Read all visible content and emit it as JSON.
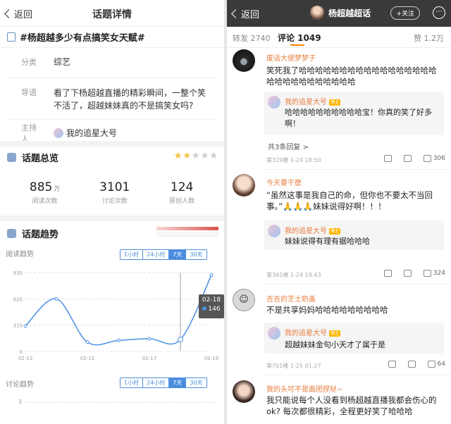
{
  "left": {
    "back_label": "返回",
    "title": "话题详情",
    "topic": "#杨超越多少有点搞笑女天赋#",
    "category_label": "分类",
    "category_value": "综艺",
    "guide_label": "导语",
    "guide_value": "看了下杨超越直播的精彩瞬间，一整个笑不活了，超越妹妹真的不是搞笑女吗?",
    "host_label": "主持人",
    "host_value": "我的追星大号",
    "overview_title": "话题总览",
    "rating_stars": "2 of 5",
    "stats": [
      {
        "value": "885",
        "unit": "万",
        "label": "阅读次数"
      },
      {
        "value": "3101",
        "unit": "",
        "label": "讨论次数"
      },
      {
        "value": "124",
        "unit": "",
        "label": "原创人数"
      }
    ],
    "trend_title": "话题趋势",
    "read_trend_label": "阅读趋势",
    "discuss_trend_label": "讨论趋势",
    "tabs": [
      "1小时",
      "24小时",
      "7天",
      "30天"
    ],
    "active_tab": "7天",
    "tooltip_date": "02-18",
    "tooltip_value": "146",
    "discuss_axis_tick": "3"
  },
  "chart_data": {
    "type": "line",
    "title": "阅读趋势",
    "x": [
      "02-13",
      "02-14",
      "02-15",
      "02-16",
      "02-17",
      "02-18",
      "02-19"
    ],
    "x_tick_labels": [
      "02-13",
      "02-15",
      "02-17",
      "02-19"
    ],
    "values": [
      300,
      620,
      110,
      130,
      150,
      140,
      900
    ],
    "y_ticks": [
      "930",
      "620",
      "310",
      "0"
    ],
    "ylim": [
      0,
      930
    ],
    "highlight": {
      "x": "02-18",
      "value": 146
    },
    "line_color": "#4a90e2",
    "grid": true
  },
  "right": {
    "back_label": "返回",
    "page_title": "杨超越超话",
    "follow_label": "+关注",
    "tab_repost": "转发 2740",
    "tab_comment": "评论 1049",
    "tab_like": "赞 1.2万",
    "comments": [
      {
        "name": "废话大使梦梦子",
        "text": "笑死我了哈哈哈哈哈哈哈哈哈哈哈哈哈哈哈哈哈哈哈哈哈哈哈哈哈哈哈哈",
        "reply_name": "我的追星大号",
        "reply_badge": "博主",
        "reply_text": "哈哈哈哈哈哈哈哈哈哈宝！你真的笑了好多啊！",
        "more": "共3条回复 >",
        "meta": "第329楼 1-24 18:50",
        "count": "306"
      },
      {
        "name": "今天要干麽",
        "text": "“虽然这事是我自己的命，但你也不要太不当回事。”🙏🙏🙏妹妹说得好啊！！！",
        "reply_name": "我的追星大号",
        "reply_badge": "博主",
        "reply_text": "妹妹说得有理有据哈哈哈",
        "more": "",
        "meta": "第361楼 1-24 19:43",
        "count": "324"
      },
      {
        "name": "吉吉的芝士奶盖",
        "text": "不是共享妈妈哈哈哈哈哈哈哈哈哈",
        "reply_name": "我的追星大号",
        "reply_badge": "博主",
        "reply_text": "超越妹妹金句小天才了属于是",
        "more": "",
        "meta": "第701楼 1-25 01:27",
        "count": "64"
      },
      {
        "name": "我的头可不是面团捏哒~",
        "text": "我只能说每个人没看到杨超越直播我都会伤心的ok? 每次都很精彩，全程更好笑了哈哈哈",
        "meta": "",
        "count": ""
      }
    ]
  }
}
